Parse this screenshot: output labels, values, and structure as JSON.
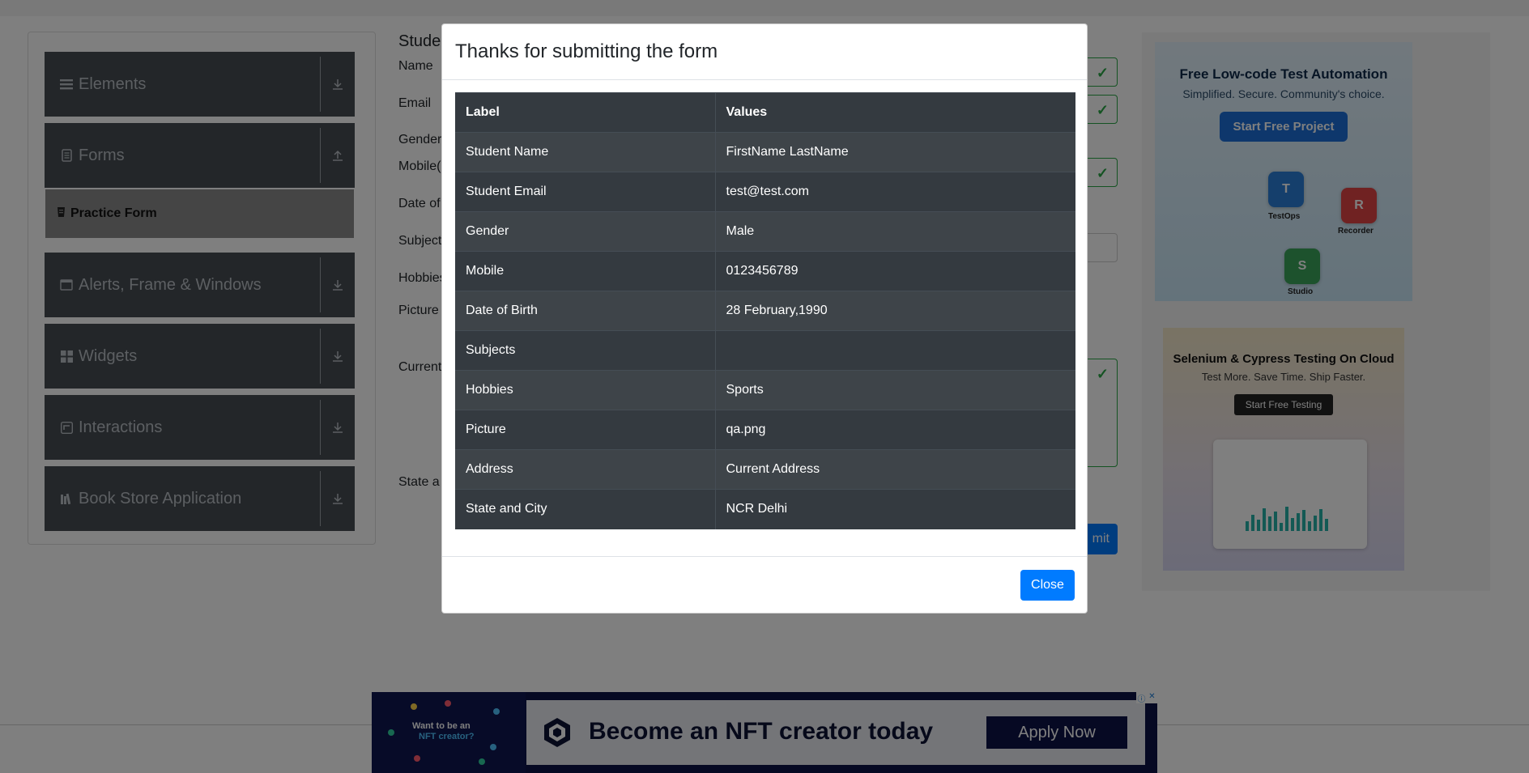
{
  "sidebar": {
    "groups": [
      {
        "label": "Elements",
        "icon": "list-icon",
        "arrow": "download-arrow-icon"
      },
      {
        "label": "Forms",
        "icon": "document-icon",
        "arrow": "upload-arrow-icon"
      },
      {
        "label": "Alerts, Frame & Windows",
        "icon": "window-icon",
        "arrow": "download-arrow-icon"
      },
      {
        "label": "Widgets",
        "icon": "widgets-icon",
        "arrow": "download-arrow-icon"
      },
      {
        "label": "Interactions",
        "icon": "interactions-icon",
        "arrow": "download-arrow-icon"
      },
      {
        "label": "Book Store Application",
        "icon": "books-icon",
        "arrow": "download-arrow-icon"
      }
    ],
    "active_item": {
      "label": "Practice Form",
      "icon": "form-icon"
    }
  },
  "form": {
    "title_partial": "Stude",
    "labels": {
      "name": "Name",
      "email": "Email",
      "gender": "Gender",
      "mobile": "Mobile(",
      "dob": "Date of",
      "subjects": "Subject",
      "hobbies": "Hobbies",
      "picture": "Picture",
      "address": "Current",
      "state": "State a"
    },
    "submit_label": "mit"
  },
  "ads": {
    "right1": {
      "title": "Free Low-code Test Automation",
      "subtitle": "Simplified. Secure. Community's choice.",
      "button": "Start Free Project",
      "products": [
        "TestOps",
        "Recorder",
        "Studio"
      ]
    },
    "right2": {
      "title": "Selenium & Cypress Testing On Cloud",
      "subtitle": "Test More. Save Time. Ship Faster.",
      "button": "Start Free Testing"
    },
    "bottom": {
      "side_line1": "Want to be an",
      "side_line2": "NFT creator?",
      "headline": "Become an NFT creator today",
      "button": "Apply Now"
    }
  },
  "modal": {
    "title": "Thanks for submitting the form",
    "headers": [
      "Label",
      "Values"
    ],
    "rows": [
      {
        "label": "Student Name",
        "value": "FirstName LastName"
      },
      {
        "label": "Student Email",
        "value": "test@test.com"
      },
      {
        "label": "Gender",
        "value": "Male"
      },
      {
        "label": "Mobile",
        "value": "0123456789"
      },
      {
        "label": "Date of Birth",
        "value": "28 February,1990"
      },
      {
        "label": "Subjects",
        "value": ""
      },
      {
        "label": "Hobbies",
        "value": "Sports"
      },
      {
        "label": "Picture",
        "value": "qa.png"
      },
      {
        "label": "Address",
        "value": "Current Address"
      },
      {
        "label": "State and City",
        "value": "NCR Delhi"
      }
    ],
    "close_label": "Close"
  },
  "colors": {
    "primary": "#007bff",
    "table_dark": "#343a40",
    "sidebar_group": "#464c52",
    "valid_green": "#28a745"
  }
}
